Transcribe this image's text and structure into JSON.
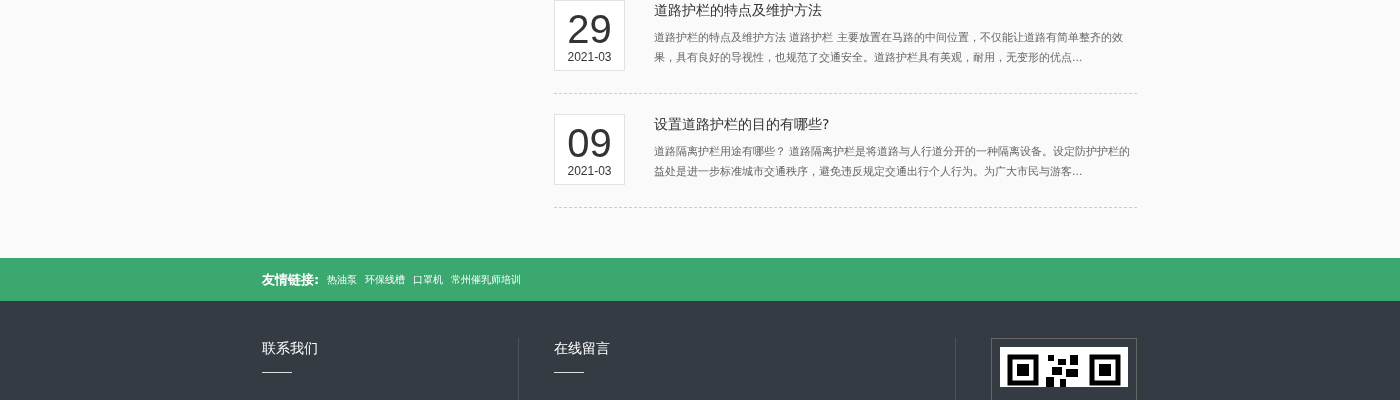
{
  "news": [
    {
      "day": "29",
      "month": "2021-03",
      "title": "道路护栏的特点及维护方法",
      "summary": "道路护栏的特点及维护方法 道路护栏 主要放置在马路的中间位置，不仅能让道路有简单整齐的效果，具有良好的导视性，也规范了交通安全。道路护栏具有美观，耐用，无变形的优点..."
    },
    {
      "day": "09",
      "month": "2021-03",
      "title": "设置道路护栏的目的有哪些?",
      "summary": "道路隔离护栏用途有哪些？  道路隔离护栏是将道路与人行道分开的一种隔离设备。设定防护护栏的益处是进一步标准城市交通秩序，避免违反规定交通出行个人行为。为广大市民与游客..."
    }
  ],
  "friend_links": {
    "label": "友情链接:",
    "links": [
      "热油泵",
      "环保线槽",
      "口罩机",
      "常州催乳师培训"
    ]
  },
  "footer": {
    "columns": [
      "联系我们",
      "在线留言"
    ]
  }
}
